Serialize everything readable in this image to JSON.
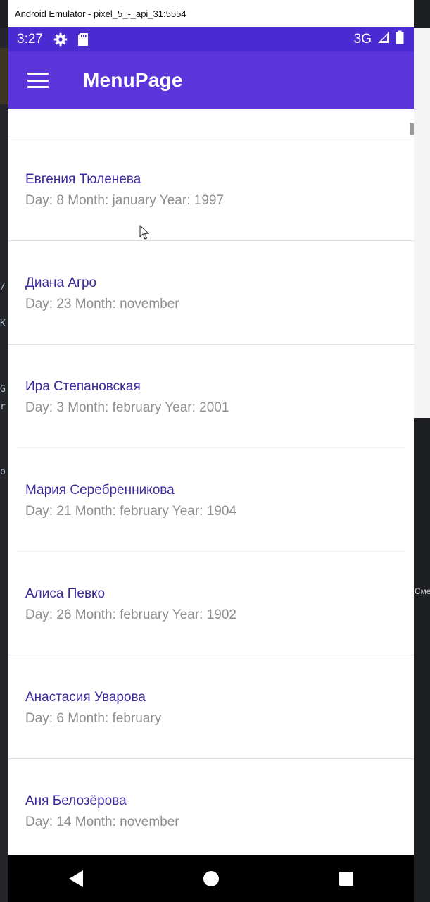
{
  "window": {
    "title": "Android Emulator - pixel_5_-_api_31:5554"
  },
  "status_bar": {
    "time": "3:27",
    "network": "3G",
    "icons": [
      "settings-icon",
      "sd-card-icon",
      "signal-icon",
      "battery-icon"
    ]
  },
  "app_bar": {
    "title": "MenuPage",
    "menu_icon": "hamburger-menu-icon"
  },
  "list": {
    "items": [
      {
        "name": "Евгения Тюленева",
        "detail": "Day: 8 Month: january Year: 1997"
      },
      {
        "name": "Диана Агро",
        "detail": "Day: 23 Month: november"
      },
      {
        "name": "Ира Степановская",
        "detail": "Day: 3 Month: february Year: 2001"
      },
      {
        "name": "Мария Серебренникова",
        "detail": "Day: 21 Month: february Year: 1904"
      },
      {
        "name": "Алиса Певко",
        "detail": "Day: 26 Month: february Year: 1902"
      },
      {
        "name": "Анастасия Уварова",
        "detail": "Day: 6 Month: february"
      },
      {
        "name": "Аня Белозёрова",
        "detail": "Day: 14 Month: november"
      }
    ]
  },
  "nav_bar": {
    "icons": [
      "back-icon",
      "home-icon",
      "recents-icon"
    ]
  },
  "background": {
    "right_label": "Сме",
    "left_glyphs": [
      "/",
      "К",
      "G",
      "r",
      "o"
    ]
  },
  "colors": {
    "status_bar": "#4a2ad1",
    "app_bar": "#5b35d9",
    "item_name": "#3a2a9c",
    "item_detail": "#8e8e8e"
  }
}
